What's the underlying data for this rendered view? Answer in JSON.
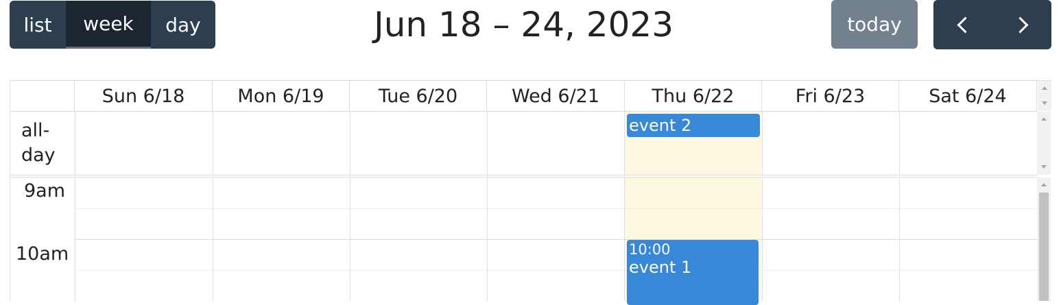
{
  "toolbar": {
    "views": [
      "list",
      "week",
      "day"
    ],
    "active_view": "week",
    "title": "Jun 18 – 24, 2023",
    "today_label": "today",
    "prev_icon": "chevron-left-icon",
    "next_icon": "chevron-right-icon"
  },
  "columns": [
    "Sun 6/18",
    "Mon 6/19",
    "Tue 6/20",
    "Wed 6/21",
    "Thu 6/22",
    "Fri 6/23",
    "Sat 6/24"
  ],
  "today_column": "Thu 6/22",
  "allday_label_1": "all-",
  "allday_label_2": "day",
  "time_labels": [
    "9am",
    "10am"
  ],
  "events": {
    "allday": {
      "title": "event 2",
      "day": "Thu 6/22"
    },
    "timed": {
      "time": "10:00",
      "title": "event 1",
      "day": "Thu 6/22"
    }
  },
  "colors": {
    "toolbar_button": "#2c3e50",
    "active_button": "#1b2631",
    "today_button": "#6c7a89",
    "event": "#3788d8",
    "today_highlight": "#fdf8e0"
  }
}
